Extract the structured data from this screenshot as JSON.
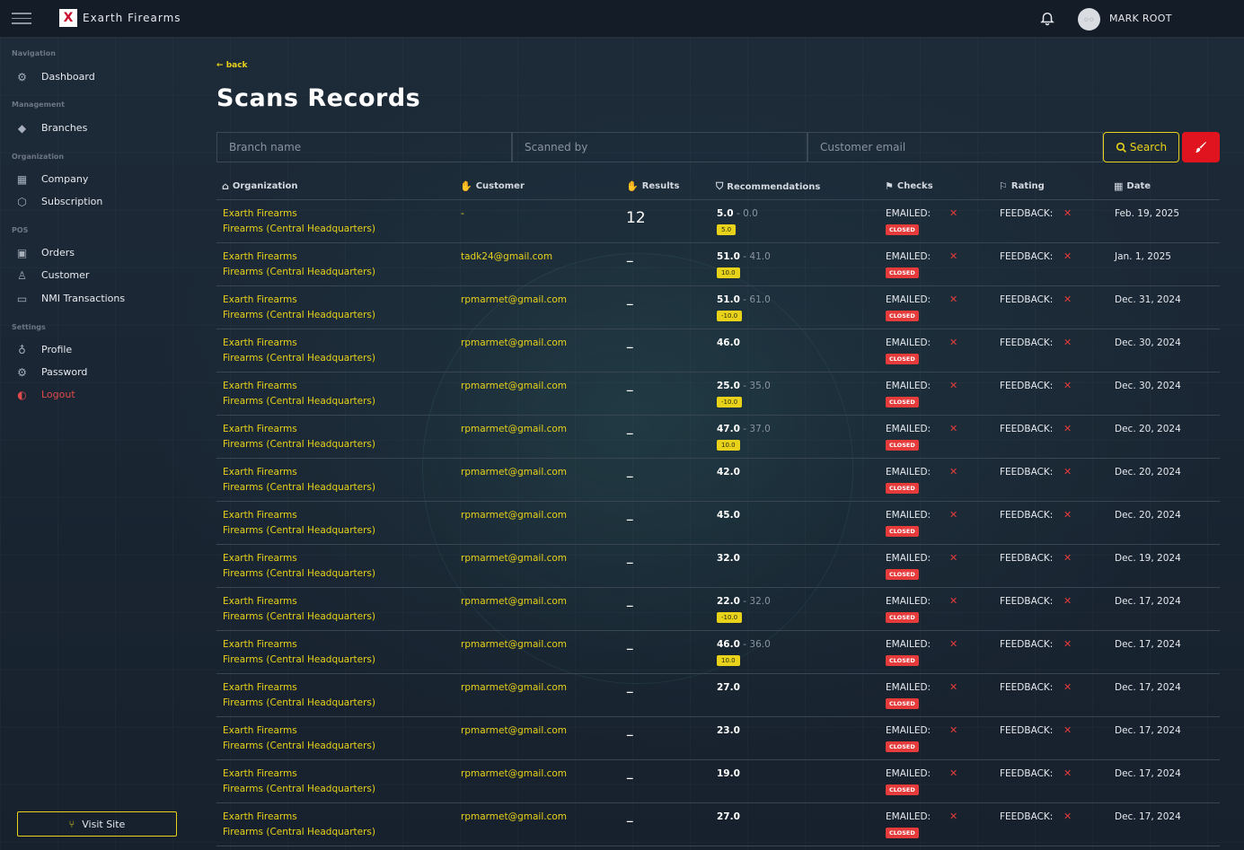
{
  "app": {
    "brand": "Exarth Firearms",
    "logo_glyph": "X",
    "user_name": "MARK ROOT",
    "avatar_text": "○ ○"
  },
  "sidebar": {
    "sections": [
      {
        "title": "Navigation",
        "items": [
          {
            "label": "Dashboard",
            "icon": "gear-cog-icon"
          }
        ]
      },
      {
        "title": "Management",
        "items": [
          {
            "label": "Branches",
            "icon": "branch-diamond-icon"
          }
        ]
      },
      {
        "title": "Organization",
        "items": [
          {
            "label": "Company",
            "icon": "building-icon"
          },
          {
            "label": "Subscription",
            "icon": "cube-icon"
          }
        ]
      },
      {
        "title": "POS",
        "items": [
          {
            "label": "Orders",
            "icon": "bag-icon"
          },
          {
            "label": "Customer",
            "icon": "user-icon"
          },
          {
            "label": "NMI Transactions",
            "icon": "card-icon"
          }
        ]
      },
      {
        "title": "Settings",
        "items": [
          {
            "label": "Profile",
            "icon": "bulb-icon"
          },
          {
            "label": "Password",
            "icon": "gear-icon"
          },
          {
            "label": "Logout",
            "icon": "toggle-icon"
          }
        ]
      }
    ],
    "visit_site": "Visit Site"
  },
  "main": {
    "back_label": "back",
    "title": "Scans Records",
    "filters": {
      "branch_placeholder": "Branch name",
      "scanned_by_placeholder": "Scanned by",
      "customer_email_placeholder": "Customer email",
      "search_label": "Search"
    },
    "columns": [
      "Organization",
      "Customer",
      "Results",
      "Recommendations",
      "Checks",
      "Rating",
      "Date"
    ],
    "rows": [
      {
        "org": "Exarth Firearms",
        "branch": "Firearms (Central Headquarters)",
        "customer": "-",
        "result": "12",
        "rec": "5.0",
        "rec_sep": " - ",
        "rec_prev": "0.0",
        "badge": "5.0",
        "emailed": "EMAILED:",
        "status": "CLOSED",
        "feedback": "FEEDBACK:",
        "date": "Feb. 19, 2025"
      },
      {
        "org": "Exarth Firearms",
        "branch": "Firearms (Central Headquarters)",
        "customer": "tadk24@gmail.com",
        "result": "–",
        "rec": "51.0",
        "rec_sep": " - ",
        "rec_prev": "41.0",
        "badge": "10.0",
        "emailed": "EMAILED:",
        "status": "CLOSED",
        "feedback": "FEEDBACK:",
        "date": "Jan. 1, 2025"
      },
      {
        "org": "Exarth Firearms",
        "branch": "Firearms (Central Headquarters)",
        "customer": "rpmarmet@gmail.com",
        "result": "–",
        "rec": "51.0",
        "rec_sep": " - ",
        "rec_prev": "61.0",
        "badge": "-10.0",
        "emailed": "EMAILED:",
        "status": "CLOSED",
        "feedback": "FEEDBACK:",
        "date": "Dec. 31, 2024"
      },
      {
        "org": "Exarth Firearms",
        "branch": "Firearms (Central Headquarters)",
        "customer": "rpmarmet@gmail.com",
        "result": "–",
        "rec": "46.0",
        "rec_sep": "",
        "rec_prev": "",
        "badge": "",
        "emailed": "EMAILED:",
        "status": "CLOSED",
        "feedback": "FEEDBACK:",
        "date": "Dec. 30, 2024"
      },
      {
        "org": "Exarth Firearms",
        "branch": "Firearms (Central Headquarters)",
        "customer": "rpmarmet@gmail.com",
        "result": "–",
        "rec": "25.0",
        "rec_sep": " - ",
        "rec_prev": "35.0",
        "badge": "-10.0",
        "emailed": "EMAILED:",
        "status": "CLOSED",
        "feedback": "FEEDBACK:",
        "date": "Dec. 30, 2024"
      },
      {
        "org": "Exarth Firearms",
        "branch": "Firearms (Central Headquarters)",
        "customer": "rpmarmet@gmail.com",
        "result": "–",
        "rec": "47.0",
        "rec_sep": " - ",
        "rec_prev": "37.0",
        "badge": "10.0",
        "emailed": "EMAILED:",
        "status": "CLOSED",
        "feedback": "FEEDBACK:",
        "date": "Dec. 20, 2024"
      },
      {
        "org": "Exarth Firearms",
        "branch": "Firearms (Central Headquarters)",
        "customer": "rpmarmet@gmail.com",
        "result": "–",
        "rec": "42.0",
        "rec_sep": "",
        "rec_prev": "",
        "badge": "",
        "emailed": "EMAILED:",
        "status": "CLOSED",
        "feedback": "FEEDBACK:",
        "date": "Dec. 20, 2024"
      },
      {
        "org": "Exarth Firearms",
        "branch": "Firearms (Central Headquarters)",
        "customer": "rpmarmet@gmail.com",
        "result": "–",
        "rec": "45.0",
        "rec_sep": "",
        "rec_prev": "",
        "badge": "",
        "emailed": "EMAILED:",
        "status": "CLOSED",
        "feedback": "FEEDBACK:",
        "date": "Dec. 20, 2024"
      },
      {
        "org": "Exarth Firearms",
        "branch": "Firearms (Central Headquarters)",
        "customer": "rpmarmet@gmail.com",
        "result": "–",
        "rec": "32.0",
        "rec_sep": "",
        "rec_prev": "",
        "badge": "",
        "emailed": "EMAILED:",
        "status": "CLOSED",
        "feedback": "FEEDBACK:",
        "date": "Dec. 19, 2024"
      },
      {
        "org": "Exarth Firearms",
        "branch": "Firearms (Central Headquarters)",
        "customer": "rpmarmet@gmail.com",
        "result": "–",
        "rec": "22.0",
        "rec_sep": " - ",
        "rec_prev": "32.0",
        "badge": "-10.0",
        "emailed": "EMAILED:",
        "status": "CLOSED",
        "feedback": "FEEDBACK:",
        "date": "Dec. 17, 2024"
      },
      {
        "org": "Exarth Firearms",
        "branch": "Firearms (Central Headquarters)",
        "customer": "rpmarmet@gmail.com",
        "result": "–",
        "rec": "46.0",
        "rec_sep": " - ",
        "rec_prev": "36.0",
        "badge": "10.0",
        "emailed": "EMAILED:",
        "status": "CLOSED",
        "feedback": "FEEDBACK:",
        "date": "Dec. 17, 2024"
      },
      {
        "org": "Exarth Firearms",
        "branch": "Firearms (Central Headquarters)",
        "customer": "rpmarmet@gmail.com",
        "result": "–",
        "rec": "27.0",
        "rec_sep": "",
        "rec_prev": "",
        "badge": "",
        "emailed": "EMAILED:",
        "status": "CLOSED",
        "feedback": "FEEDBACK:",
        "date": "Dec. 17, 2024"
      },
      {
        "org": "Exarth Firearms",
        "branch": "Firearms (Central Headquarters)",
        "customer": "rpmarmet@gmail.com",
        "result": "–",
        "rec": "23.0",
        "rec_sep": "",
        "rec_prev": "",
        "badge": "",
        "emailed": "EMAILED:",
        "status": "CLOSED",
        "feedback": "FEEDBACK:",
        "date": "Dec. 17, 2024"
      },
      {
        "org": "Exarth Firearms",
        "branch": "Firearms (Central Headquarters)",
        "customer": "rpmarmet@gmail.com",
        "result": "–",
        "rec": "19.0",
        "rec_sep": "",
        "rec_prev": "",
        "badge": "",
        "emailed": "EMAILED:",
        "status": "CLOSED",
        "feedback": "FEEDBACK:",
        "date": "Dec. 17, 2024"
      },
      {
        "org": "Exarth Firearms",
        "branch": "Firearms (Central Headquarters)",
        "customer": "rpmarmet@gmail.com",
        "result": "–",
        "rec": "27.0",
        "rec_sep": "",
        "rec_prev": "",
        "badge": "",
        "emailed": "EMAILED:",
        "status": "CLOSED",
        "feedback": "FEEDBACK:",
        "date": "Dec. 17, 2024"
      }
    ]
  },
  "colors": {
    "accent": "#e8d21a",
    "danger": "#e53b3b",
    "background": "#1b2533",
    "topbar": "#141c27"
  }
}
